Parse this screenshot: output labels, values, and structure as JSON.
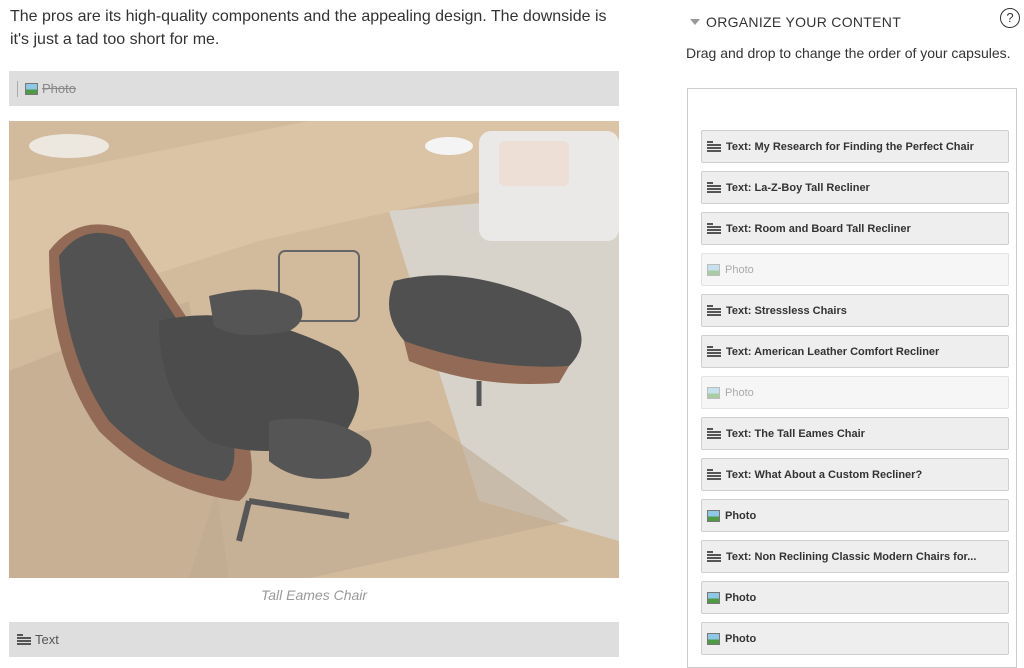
{
  "article": {
    "intro_text": "The pros are its high-quality components and the appealing design. The downside is it's just a tad too short for me.",
    "photo_capsule_label": "Photo",
    "photo_caption": "Tall Eames Chair",
    "text_capsule_label": "Text"
  },
  "organizer": {
    "title": "ORGANIZE YOUR CONTENT",
    "help_glyph": "?",
    "subtitle": "Drag and drop to change the order of your capsules.",
    "items": [
      {
        "type": "text",
        "label": "Text: My Research for Finding the Perfect Chair",
        "faded": false
      },
      {
        "type": "text",
        "label": "Text: La-Z-Boy Tall Recliner",
        "faded": false
      },
      {
        "type": "text",
        "label": "Text: Room and Board Tall Recliner",
        "faded": false
      },
      {
        "type": "photo",
        "label": "Photo",
        "faded": true
      },
      {
        "type": "text",
        "label": "Text: Stressless Chairs",
        "faded": false
      },
      {
        "type": "text",
        "label": "Text: American Leather Comfort Recliner",
        "faded": false
      },
      {
        "type": "photo",
        "label": "Photo",
        "faded": true
      },
      {
        "type": "text",
        "label": "Text: The Tall Eames Chair",
        "faded": false
      },
      {
        "type": "text",
        "label": "Text: What About a Custom Recliner?",
        "faded": false
      },
      {
        "type": "photo",
        "label": "Photo",
        "faded": false
      },
      {
        "type": "text",
        "label": "Text: Non Reclining Classic Modern Chairs for...",
        "faded": false
      },
      {
        "type": "photo",
        "label": "Photo",
        "faded": false
      },
      {
        "type": "photo",
        "label": "Photo",
        "faded": false
      }
    ]
  },
  "icons": {
    "photo": "photo-icon",
    "text": "text-icon",
    "caret": "caret-down-icon",
    "help": "help-icon"
  }
}
